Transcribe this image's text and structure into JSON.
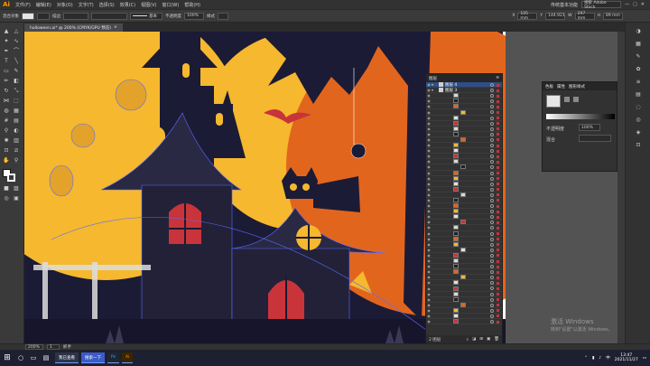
{
  "app": {
    "logo": "Ai",
    "menu": [
      "文件(F)",
      "编辑(E)",
      "对象(O)",
      "文字(T)",
      "选择(S)",
      "效果(C)",
      "视图(V)",
      "窗口(W)",
      "帮助(H)"
    ],
    "workspace": "传统基本功能",
    "search_placeholder": "搜索 Adobe Stock"
  },
  "control_bar": {
    "selection_label": "混合对象",
    "stroke_label": "描边",
    "stroke_value": "",
    "brush_label": "基本",
    "opacity_label": "不透明度",
    "opacity_value": "100%",
    "style_label": "样式",
    "x_label": "X",
    "x_value": "105 mm",
    "y_label": "Y",
    "y_value": "144.921",
    "w_label": "W",
    "w_value": "297 mm",
    "h_label": "H",
    "h_value": "89 mm"
  },
  "document_tab": {
    "title": "halloween.ai* @ 200% (CMYK/GPU 预览)",
    "close": "×"
  },
  "layers_panel": {
    "tabs": [
      "图层"
    ],
    "layers": [
      {
        "name": "图层 4"
      },
      {
        "name": "图层 3"
      }
    ],
    "row_count": 44,
    "footer_label": "2 图层"
  },
  "properties_panel": {
    "tabs": [
      "色板",
      "属性",
      "图形样式"
    ],
    "opacity_label": "不透明度",
    "opacity_value": "100%",
    "blend_label": "混合"
  },
  "status_bar": {
    "zoom": "200%",
    "page": "1",
    "tool": "抓手"
  },
  "watermark": {
    "line1": "激活 Windows",
    "line2": "转到\"设置\"以激活 Windows。"
  },
  "taskbar": {
    "search_app": "我已查看",
    "browser_app": "搜索一下",
    "ai_app": "Ai",
    "time": "13:47",
    "date": "2021/11/27",
    "lang": "中"
  },
  "colors": {
    "moon": "#f5b82e",
    "night": "#1c1b35",
    "orange": "#e2651e",
    "accent": "#ff9a00",
    "selection": "#5b6bff"
  }
}
